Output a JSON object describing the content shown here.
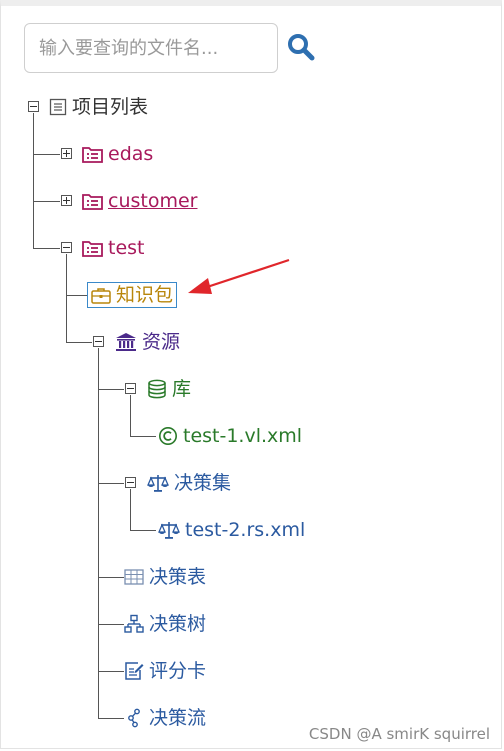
{
  "search": {
    "placeholder": "输入要查询的文件名...",
    "button_icon": "search-icon"
  },
  "colors": {
    "project": "#a8195c",
    "knowledge": "#b8860b",
    "resource": "#4b2a8a",
    "library": "#2a7a2a",
    "decision": "#2b5aa0",
    "arrow": "#e0262b"
  },
  "tree": {
    "root": {
      "label": "项目列表",
      "icon": "list-icon",
      "expanded": true
    },
    "projects": [
      {
        "label": "edas",
        "icon": "project-list-icon",
        "expanded": false
      },
      {
        "label": "customer",
        "icon": "project-list-icon",
        "expanded": false
      },
      {
        "label": "test",
        "icon": "project-list-icon",
        "expanded": true
      }
    ],
    "knowledge_package": {
      "label": "知识包",
      "icon": "briefcase-icon",
      "selected": true
    },
    "resources": {
      "label": "资源",
      "icon": "bank-icon",
      "expanded": true
    },
    "library": {
      "label": "库",
      "icon": "database-icon",
      "expanded": true
    },
    "library_file": {
      "label": "test-1.vl.xml",
      "icon": "copyright-icon"
    },
    "decision_set": {
      "label": "决策集",
      "icon": "scale-icon",
      "expanded": true
    },
    "decision_set_file": {
      "label": "test-2.rs.xml",
      "icon": "scale-icon"
    },
    "decision_table": {
      "label": "决策表",
      "icon": "table-icon"
    },
    "decision_tree": {
      "label": "决策树",
      "icon": "sitemap-icon"
    },
    "scorecard": {
      "label": "评分卡",
      "icon": "edit-icon"
    },
    "decision_flow": {
      "label": "决策流",
      "icon": "flow-icon"
    }
  },
  "watermark": "CSDN @A smirK squirrel"
}
